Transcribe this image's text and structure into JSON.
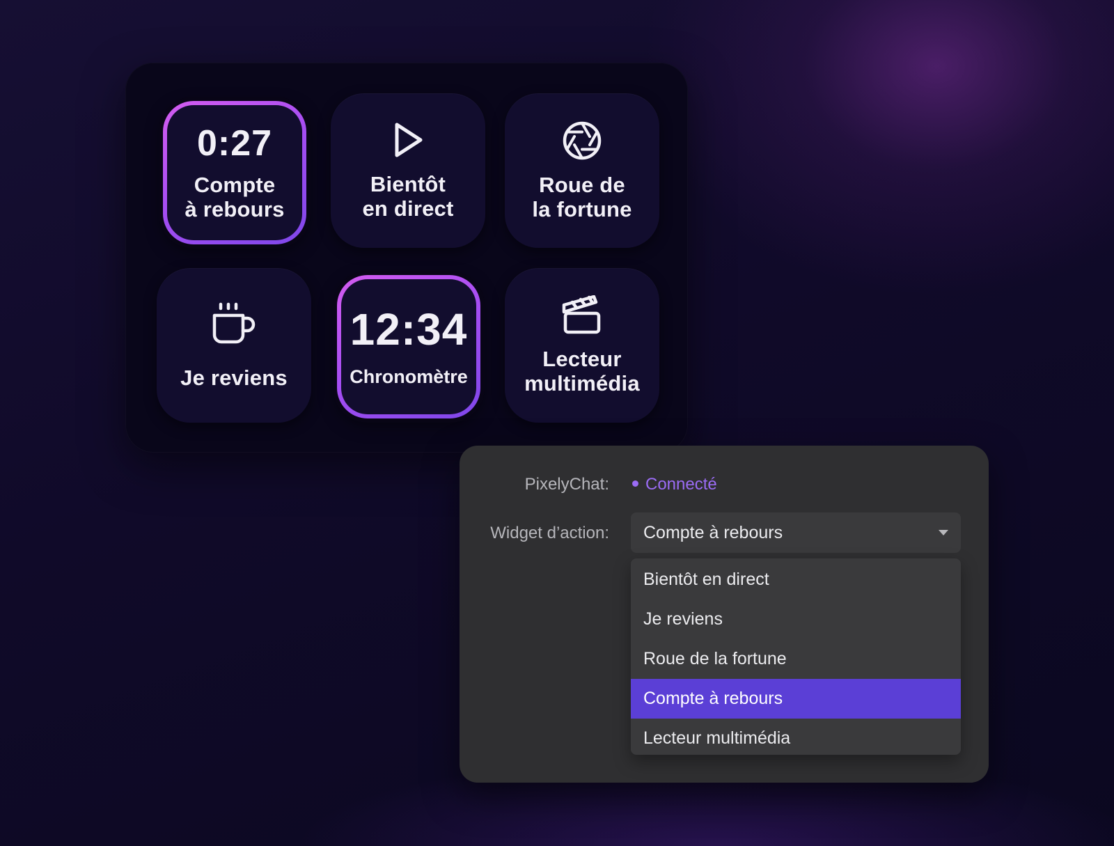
{
  "deck": {
    "keys": [
      {
        "id": "countdown",
        "time": "0:27",
        "line1": "Compte",
        "line2": "à rebours",
        "active": true
      },
      {
        "id": "starting-soon",
        "icon": "play-icon",
        "line1": "Bientôt",
        "line2": "en direct",
        "active": false
      },
      {
        "id": "wheel",
        "icon": "aperture-icon",
        "line1": "Roue de",
        "line2": "la fortune",
        "active": false
      },
      {
        "id": "be-right-back",
        "icon": "coffee-cup-icon",
        "line1": "Je reviens",
        "active": false
      },
      {
        "id": "stopwatch",
        "time": "12:34",
        "line1": "Chronomètre",
        "active": true
      },
      {
        "id": "media-player",
        "icon": "clapperboard-icon",
        "line1": "Lecteur",
        "line2": "multimédia",
        "active": false
      }
    ],
    "accent_gradient": [
      "#d45cf0",
      "#7f47ea"
    ]
  },
  "settings": {
    "service_label": "PixelyChat:",
    "status_text": "Connecté",
    "status_color": "#9b6cf5",
    "widget_label": "Widget d’action:",
    "selected_value": "Compte à rebours",
    "options": [
      {
        "label": "Bientôt en direct",
        "selected": false
      },
      {
        "label": "Je reviens",
        "selected": false
      },
      {
        "label": "Roue de la fortune",
        "selected": false
      },
      {
        "label": "Compte à rebours",
        "selected": true
      },
      {
        "label": "Lecteur multimédia",
        "selected": false
      }
    ],
    "highlight_color": "#5b3fd6"
  }
}
